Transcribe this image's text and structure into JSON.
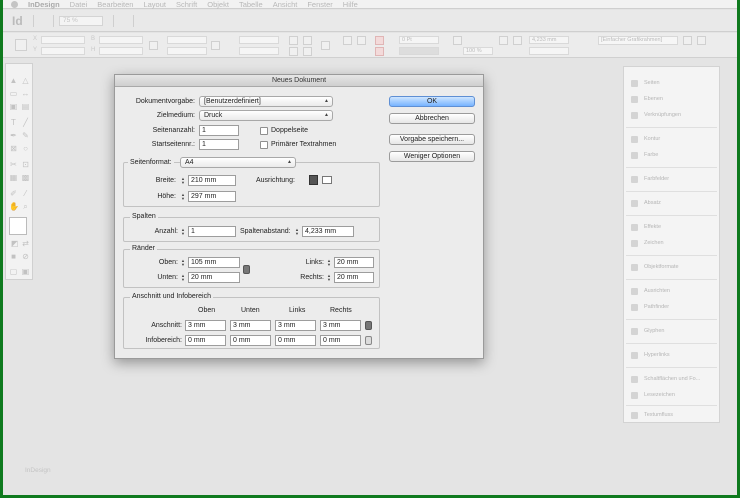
{
  "menubar": {
    "app_name": "InDesign",
    "items": [
      "Datei",
      "Bearbeiten",
      "Layout",
      "Schrift",
      "Objekt",
      "Tabelle",
      "Ansicht",
      "Fenster",
      "Hilfe"
    ]
  },
  "appbar": {
    "logo": "Id",
    "zoom": "75 %"
  },
  "controlbar": {
    "stroke_value": "0 Pt",
    "percent_value": "100 %",
    "measure_value": "4,233 mm",
    "frame_style": "[Einfacher Grafikrahmen]"
  },
  "canvas": {
    "label": "InDesign"
  },
  "right_panel": {
    "items": [
      {
        "label": "Seiten",
        "icon": "pages-icon"
      },
      {
        "label": "Ebenen",
        "icon": "layers-icon"
      },
      {
        "label": "Verknüpfungen",
        "icon": "links-icon"
      },
      {
        "label": "Kontur",
        "icon": "stroke-icon"
      },
      {
        "label": "Farbe",
        "icon": "color-icon"
      },
      {
        "label": "Farbfelder",
        "icon": "swatches-icon"
      },
      {
        "label": "Absatz",
        "icon": "paragraph-icon"
      },
      {
        "label": "Effekte",
        "icon": "effects-icon"
      },
      {
        "label": "Zeichen",
        "icon": "character-icon"
      },
      {
        "label": "Objektformate",
        "icon": "object-styles-icon"
      },
      {
        "label": "Ausrichten",
        "icon": "align-icon"
      },
      {
        "label": "Pathfinder",
        "icon": "pathfinder-icon"
      },
      {
        "label": "Glyphen",
        "icon": "glyphs-icon"
      },
      {
        "label": "Hyperlinks",
        "icon": "hyperlinks-icon"
      },
      {
        "label": "Schaltflächen und Fo...",
        "icon": "buttons-icon"
      },
      {
        "label": "Lesezeichen",
        "icon": "bookmarks-icon"
      },
      {
        "label": "Textumfluss",
        "icon": "text-wrap-icon"
      }
    ]
  },
  "dialog": {
    "title": "Neues Dokument",
    "dokumentvorgabe": {
      "label": "Dokumentvorgabe:",
      "value": "[Benutzerdefiniert]"
    },
    "zielmedium": {
      "label": "Zielmedium:",
      "value": "Druck"
    },
    "seitenanzahl": {
      "label": "Seitenanzahl:",
      "value": "1"
    },
    "startseitennr": {
      "label": "Startseitennr.:",
      "value": "1"
    },
    "doppelseite": {
      "label": "Doppelseite",
      "checked": false
    },
    "primaerer_textrahmen": {
      "label": "Primärer Textrahmen",
      "checked": false
    },
    "buttons": {
      "ok": "OK",
      "abbrechen": "Abbrechen",
      "vorgabe_speichern": "Vorgabe speichern...",
      "weniger_optionen": "Weniger Optionen"
    },
    "seitenformat": {
      "label": "Seitenformat:",
      "value": "A4",
      "breite": {
        "label": "Breite:",
        "value": "210 mm"
      },
      "hoehe": {
        "label": "Höhe:",
        "value": "297 mm"
      },
      "ausrichtung": {
        "label": "Ausrichtung:"
      }
    },
    "spalten": {
      "title": "Spalten",
      "anzahl": {
        "label": "Anzahl:",
        "value": "1"
      },
      "spaltenabstand": {
        "label": "Spaltenabstand:",
        "value": "4,233 mm"
      }
    },
    "raender": {
      "title": "Ränder",
      "oben": {
        "label": "Oben:",
        "value": "105 mm"
      },
      "unten": {
        "label": "Unten:",
        "value": "20 mm"
      },
      "links": {
        "label": "Links:",
        "value": "20 mm"
      },
      "rechts": {
        "label": "Rechts:",
        "value": "20 mm"
      }
    },
    "anschnitt": {
      "title": "Anschnitt und Infobereich",
      "headers": [
        "Oben",
        "Unten",
        "Links",
        "Rechts"
      ],
      "anschnitt_label": "Anschnitt:",
      "anschnitt_values": [
        "3 mm",
        "3 mm",
        "3 mm",
        "3 mm"
      ],
      "infobereich_label": "Infobereich:",
      "infobereich_values": [
        "0 mm",
        "0 mm",
        "0 mm",
        "0 mm"
      ]
    }
  }
}
